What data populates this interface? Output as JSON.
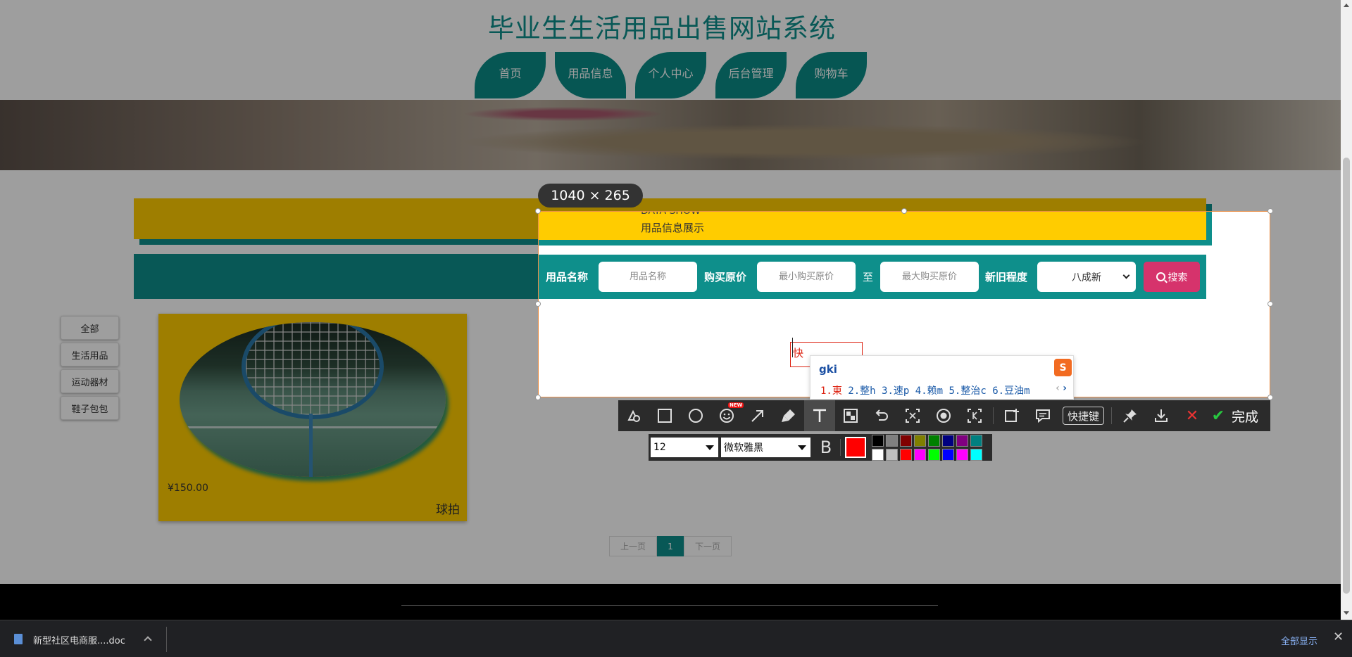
{
  "site": {
    "title": "毕业生生活用品出售网站系统",
    "nav": [
      "首页",
      "用品信息",
      "个人中心",
      "后台管理",
      "购物车"
    ],
    "section": {
      "en": "DATA SHOW",
      "cn": "用品信息展示"
    },
    "search": {
      "name_label": "用品名称",
      "name_placeholder": "用品名称",
      "price_label": "购买原价",
      "min_placeholder": "最小购买原价",
      "to_label": "至",
      "max_placeholder": "最大购买原价",
      "cond_label": "新旧程度",
      "cond_value": "八成新",
      "search_btn": "搜索"
    },
    "categories": [
      "全部",
      "生活用品",
      "运动器材",
      "鞋子包包"
    ],
    "product": {
      "price": "¥150.00",
      "name": "球拍"
    },
    "pager": {
      "prev": "上一页",
      "current": "1",
      "next": "下一页"
    }
  },
  "capture": {
    "size": "1040 × 265",
    "typed_text": "快",
    "ime": {
      "input": "gki",
      "logo": "S",
      "candidates": [
        "1.東",
        "2.整h",
        "3.速p",
        "4.赖m",
        "5.整治c",
        "6.豆油m"
      ]
    },
    "toolbar": {
      "shortcut_label": "快捷键",
      "done_label": "完成",
      "new_tag": "NEW"
    },
    "text_tool": {
      "font_size": "12",
      "font_name": "微软雅黑",
      "bold_label": "B",
      "current_color": "#ff0000",
      "palette": [
        "#000000",
        "#808080",
        "#800000",
        "#808000",
        "#008000",
        "#000080",
        "#800080",
        "#008080",
        "#ffffff",
        "#c0c0c0",
        "#ff0000",
        "#ff00ff",
        "#00ff00",
        "#0000ff",
        "#ff00ff",
        "#00ffff"
      ]
    }
  },
  "download": {
    "file": "新型社区电商服....doc",
    "show_all": "全部显示"
  },
  "colors": {
    "teal": "#0e8f8b",
    "yellow": "#ffcc00",
    "pink": "#d6336c"
  }
}
